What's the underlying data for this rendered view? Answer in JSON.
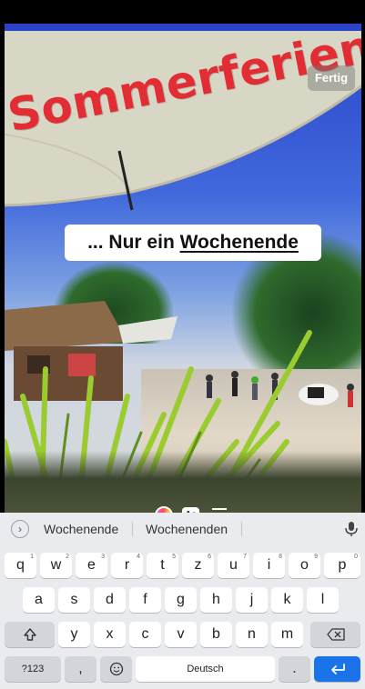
{
  "story": {
    "done_label": "Fertig",
    "sticker_text": "Sommerferien",
    "caption_prefix": "... Nur ein ",
    "caption_word": "Wochenende",
    "font_button_label": "Aa"
  },
  "colors": {
    "sticker_red": "#e12d33",
    "enter_key_blue": "#1a73e8",
    "keyboard_bg": "#e9ebee"
  },
  "keyboard": {
    "suggestions": [
      "Wochenende",
      "Wochenenden"
    ],
    "row1": [
      {
        "label": "q",
        "hint": "1"
      },
      {
        "label": "w",
        "hint": "2"
      },
      {
        "label": "e",
        "hint": "3"
      },
      {
        "label": "r",
        "hint": "4"
      },
      {
        "label": "t",
        "hint": "5"
      },
      {
        "label": "z",
        "hint": "6"
      },
      {
        "label": "u",
        "hint": "7"
      },
      {
        "label": "i",
        "hint": "8"
      },
      {
        "label": "o",
        "hint": "9"
      },
      {
        "label": "p",
        "hint": "0"
      }
    ],
    "row2": [
      "a",
      "s",
      "d",
      "f",
      "g",
      "h",
      "j",
      "k",
      "l"
    ],
    "row3": [
      "y",
      "x",
      "c",
      "v",
      "b",
      "n",
      "m"
    ],
    "symbols_label": "?123",
    "comma_label": ",",
    "space_label": "Deutsch",
    "period_label": "."
  }
}
